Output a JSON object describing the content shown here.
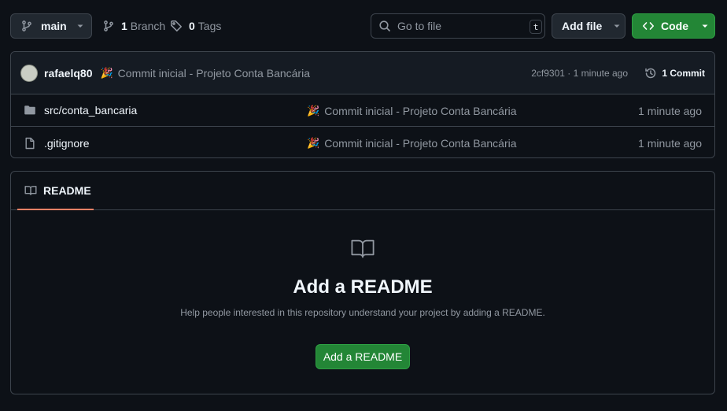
{
  "toolbar": {
    "branch": "main",
    "branch_count": "1",
    "branch_label": "Branch",
    "tag_count": "0",
    "tag_label": "Tags",
    "search_placeholder": "Go to file",
    "search_shortcut": "t",
    "add_file_label": "Add file",
    "code_label": "Code"
  },
  "commit": {
    "author": "rafaelq80",
    "emoji": "🎉",
    "message": "Commit inicial - Projeto Conta Bancária",
    "meta": "2cf9301 · 1 minute ago",
    "count_label": "1 Commit"
  },
  "files": [
    {
      "icon": "folder-icon",
      "name": "src/conta_bancaria",
      "emoji": "🎉",
      "message": "Commit inicial - Projeto Conta Bancária",
      "time": "1 minute ago"
    },
    {
      "icon": "file-icon",
      "name": ".gitignore",
      "emoji": "🎉",
      "message": "Commit inicial - Projeto Conta Bancária",
      "time": "1 minute ago"
    }
  ],
  "readme": {
    "tab_label": "README",
    "title": "Add a README",
    "description": "Help people interested in this repository understand your project by adding a README.",
    "button_label": "Add a README"
  },
  "colors": {
    "background": "#0d1117",
    "primary_button": "#238636",
    "tab_underline": "#f78166"
  }
}
